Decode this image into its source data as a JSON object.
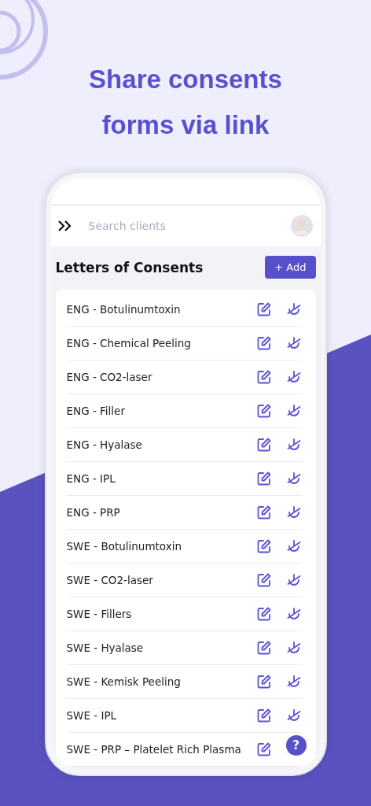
{
  "headline": "Share consents forms via link",
  "header": {
    "search": {
      "placeholder": "Search clients"
    }
  },
  "page": {
    "title": "Letters of Consents",
    "add_button": "+ Add"
  },
  "letters": [
    {
      "name": "ENG - Botulinumtoxin"
    },
    {
      "name": "ENG - Chemical Peeling"
    },
    {
      "name": "ENG - CO2-laser"
    },
    {
      "name": "ENG - Filler"
    },
    {
      "name": "ENG - Hyalase"
    },
    {
      "name": "ENG - IPL"
    },
    {
      "name": "ENG - PRP"
    },
    {
      "name": "SWE - Botulinumtoxin"
    },
    {
      "name": "SWE - CO2-laser"
    },
    {
      "name": "SWE - Fillers"
    },
    {
      "name": "SWE - Hyalase"
    },
    {
      "name": "SWE - Kemisk Peeling"
    },
    {
      "name": "SWE - IPL"
    },
    {
      "name": "SWE - PRP – Platelet Rich Plasma"
    }
  ],
  "help_button": "?"
}
